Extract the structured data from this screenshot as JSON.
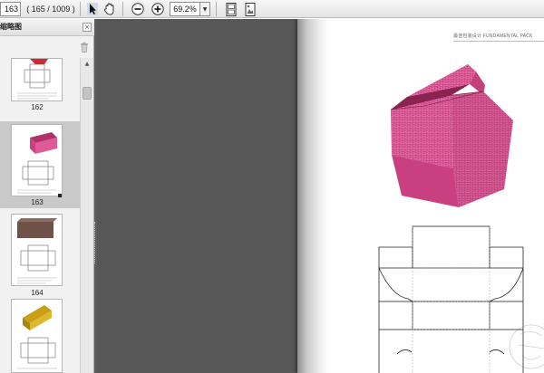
{
  "toolbar": {
    "page_number": "163",
    "page_count": "( 165 / 1009 )",
    "zoom": "69.2%",
    "icons": [
      "select-tool-icon",
      "hand-tool-icon",
      "zoom-out-icon",
      "zoom-in-icon",
      "fit-page-icon",
      "fit-width-icon"
    ]
  },
  "sidebar": {
    "title": "缩略图",
    "close_label": "×",
    "thumbnails": [
      {
        "label": "162"
      },
      {
        "label": "163",
        "selected": true
      },
      {
        "label": "164"
      },
      {
        "label": ""
      }
    ]
  },
  "document": {
    "header": "最佳包装设计  FUNDAMENTAL PACK",
    "box_color": "#d94a8c",
    "box_inner_color": "#8a2352"
  },
  "colors": {
    "dark_bg": "#575757",
    "sidebar_bg": "#f1f1f1",
    "selected_thumb": "#c9c9c9"
  }
}
